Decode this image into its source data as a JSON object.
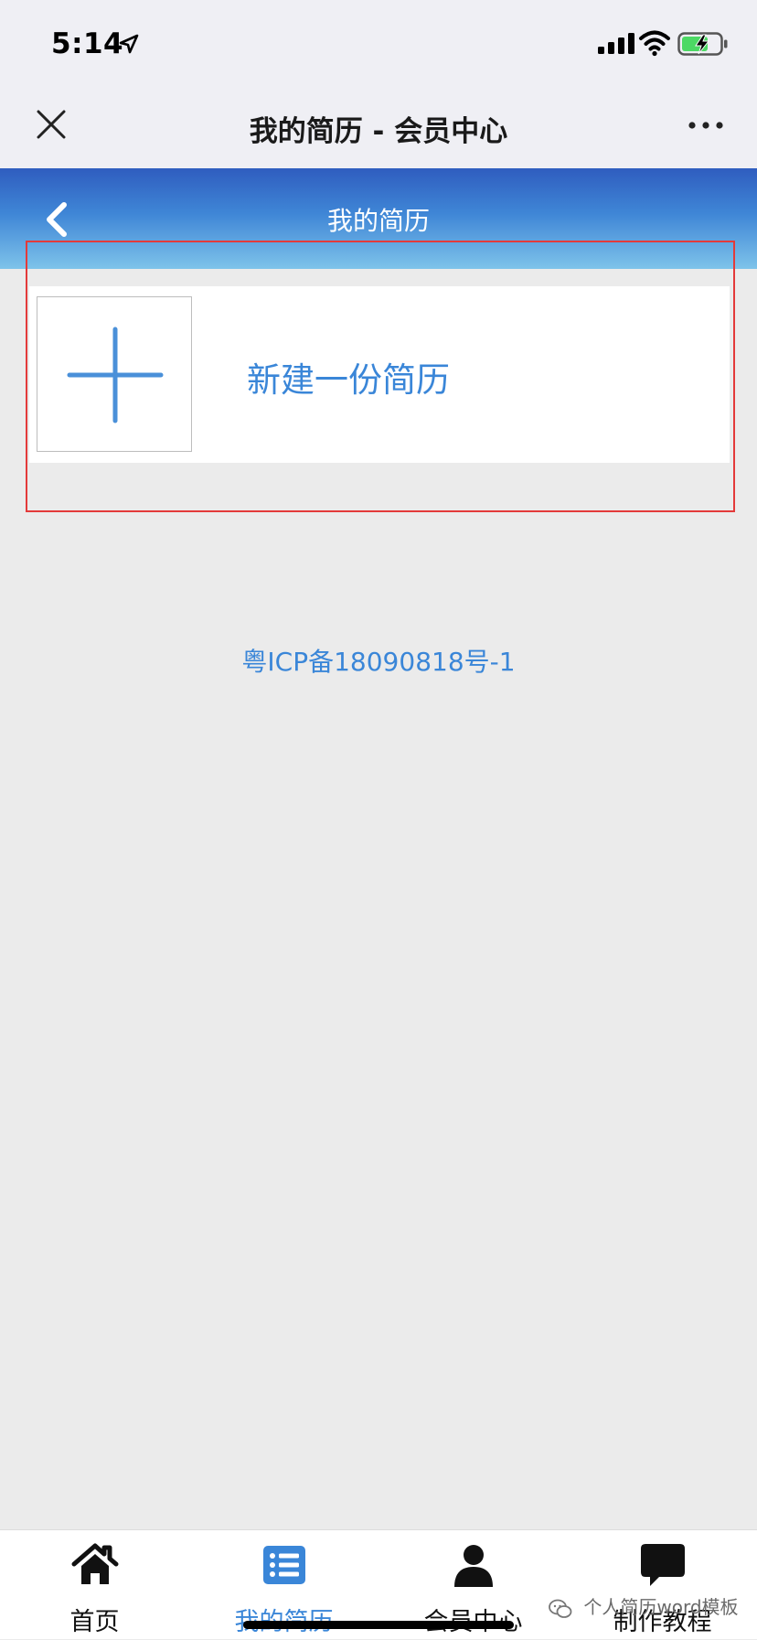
{
  "status_bar": {
    "time": "5:14",
    "location_icon": "location-arrow-icon",
    "signal_icon": "cellular-signal-icon",
    "wifi_icon": "wifi-icon",
    "battery_icon": "battery-charging-icon"
  },
  "wechat_header": {
    "title": "我的简历 - 会员中心",
    "close_icon": "close-icon",
    "more_icon": "more-icon"
  },
  "page_header": {
    "title": "我的简历",
    "back_icon": "chevron-left-icon",
    "gradient_colors": [
      "#2f5dbf",
      "#3f86d6",
      "#7ec3ea"
    ]
  },
  "main": {
    "new_resume": {
      "label": "新建一份简历",
      "icon": "plus-icon"
    },
    "icp": "粤ICP备18090818号-1"
  },
  "tab_bar": {
    "items": [
      {
        "label": "首页",
        "icon": "home-icon",
        "active": false
      },
      {
        "label": "我的简历",
        "icon": "list-icon",
        "active": true
      },
      {
        "label": "会员中心",
        "icon": "user-icon",
        "active": false
      },
      {
        "label": "制作教程",
        "icon": "chat-bubble-icon",
        "active": false
      }
    ]
  },
  "watermark": {
    "text": "个人简历word模板",
    "icon": "wechat-icon"
  },
  "colors": {
    "accent": "#3a86d8",
    "highlight_border": "#e33a3a",
    "background": "#ebebeb"
  }
}
